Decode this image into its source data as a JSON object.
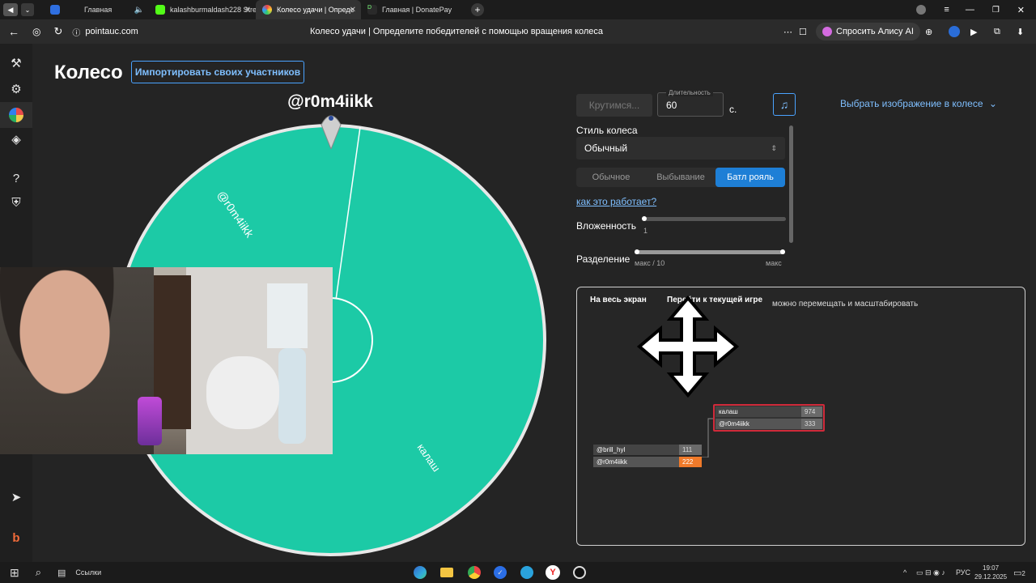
{
  "browser": {
    "tabs": [
      {
        "label": "Главная"
      },
      {
        "label": "kalashburmaldash228 Stre"
      },
      {
        "label": "Колесо удачи | Опреде"
      },
      {
        "label": "Главная | DonatePay"
      }
    ],
    "url": "pointauc.com",
    "page_title": "Колесо удачи | Определите победителей с помощью вращения колеса",
    "alice_button": "Спросить Алису AI"
  },
  "header": {
    "title": "Колесо",
    "import_button": "Импортировать своих участников"
  },
  "wheel": {
    "winner_label": "@r0m4iikk",
    "segments": [
      {
        "label": "@r0m4iikk"
      },
      {
        "label": "калаш"
      }
    ],
    "color": "#1ccaa6"
  },
  "controls": {
    "spin_button": "Крутимся...",
    "duration_label": "Длительность",
    "duration_value": "60",
    "duration_unit": "с.",
    "image_select": "Выбрать изображение в колесе",
    "style_label": "Стиль колеса",
    "style_value": "Обычный",
    "modes": [
      "Обычное",
      "Выбывание",
      "Батл рояль"
    ],
    "active_mode": "Батл рояль",
    "how_link": "как это работает?",
    "nesting_label": "Вложенность",
    "nesting_value": "1",
    "split_label": "Разделение",
    "split_min": "макс / 10",
    "split_max": "макс"
  },
  "bracket": {
    "fullscreen": "На весь экран",
    "goto_game": "Перейти к текущей игре",
    "hint": "можно перемещать и масштабировать",
    "match1": [
      {
        "name": "@brill_hyl",
        "value": "111"
      },
      {
        "name": "@r0m4iikk",
        "value": "222"
      }
    ],
    "match2": [
      {
        "name": "калаш",
        "value": "974"
      },
      {
        "name": "@r0m4iikk",
        "value": "333"
      }
    ]
  },
  "taskbar": {
    "links": "Ссылки",
    "lang": "РУС",
    "time": "19:07",
    "date": "29.12.2025",
    "notif": "2"
  }
}
